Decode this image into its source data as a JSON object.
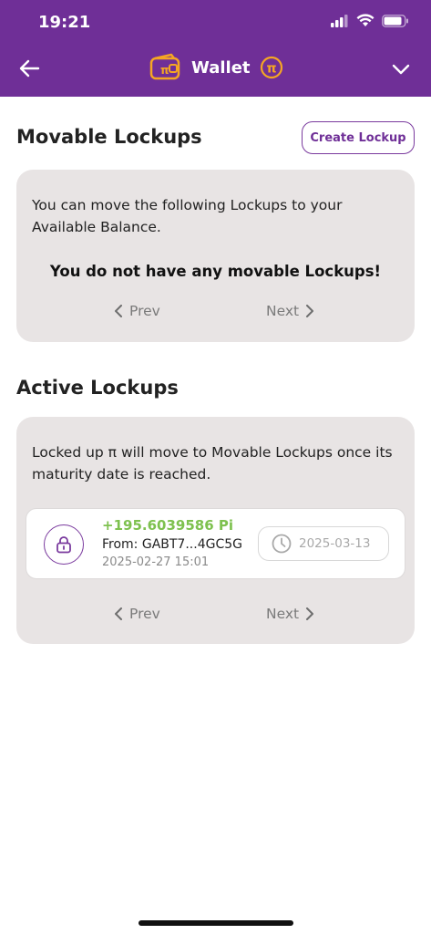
{
  "status_bar": {
    "time": "19:21"
  },
  "nav": {
    "title": "Wallet"
  },
  "movable": {
    "title": "Movable Lockups",
    "create_label": "Create Lockup",
    "description": "You can move the following Lockups to your Available Balance.",
    "empty_message": "You do not have any movable Lockups!",
    "prev_label": "Prev",
    "next_label": "Next"
  },
  "active": {
    "title": "Active Lockups",
    "description": "Locked up π will move to Movable Lockups once its maturity date is reached.",
    "items": [
      {
        "amount": "+195.6039586 Pi",
        "from": "From: GABT7...4GC5G",
        "date": "2025-02-27 15:01",
        "maturity": "2025-03-13"
      }
    ],
    "prev_label": "Prev",
    "next_label": "Next"
  },
  "colors": {
    "brand": "#6f2f97",
    "accent": "#f5a623",
    "positive": "#7ec14f",
    "card": "#e8e4e4"
  }
}
